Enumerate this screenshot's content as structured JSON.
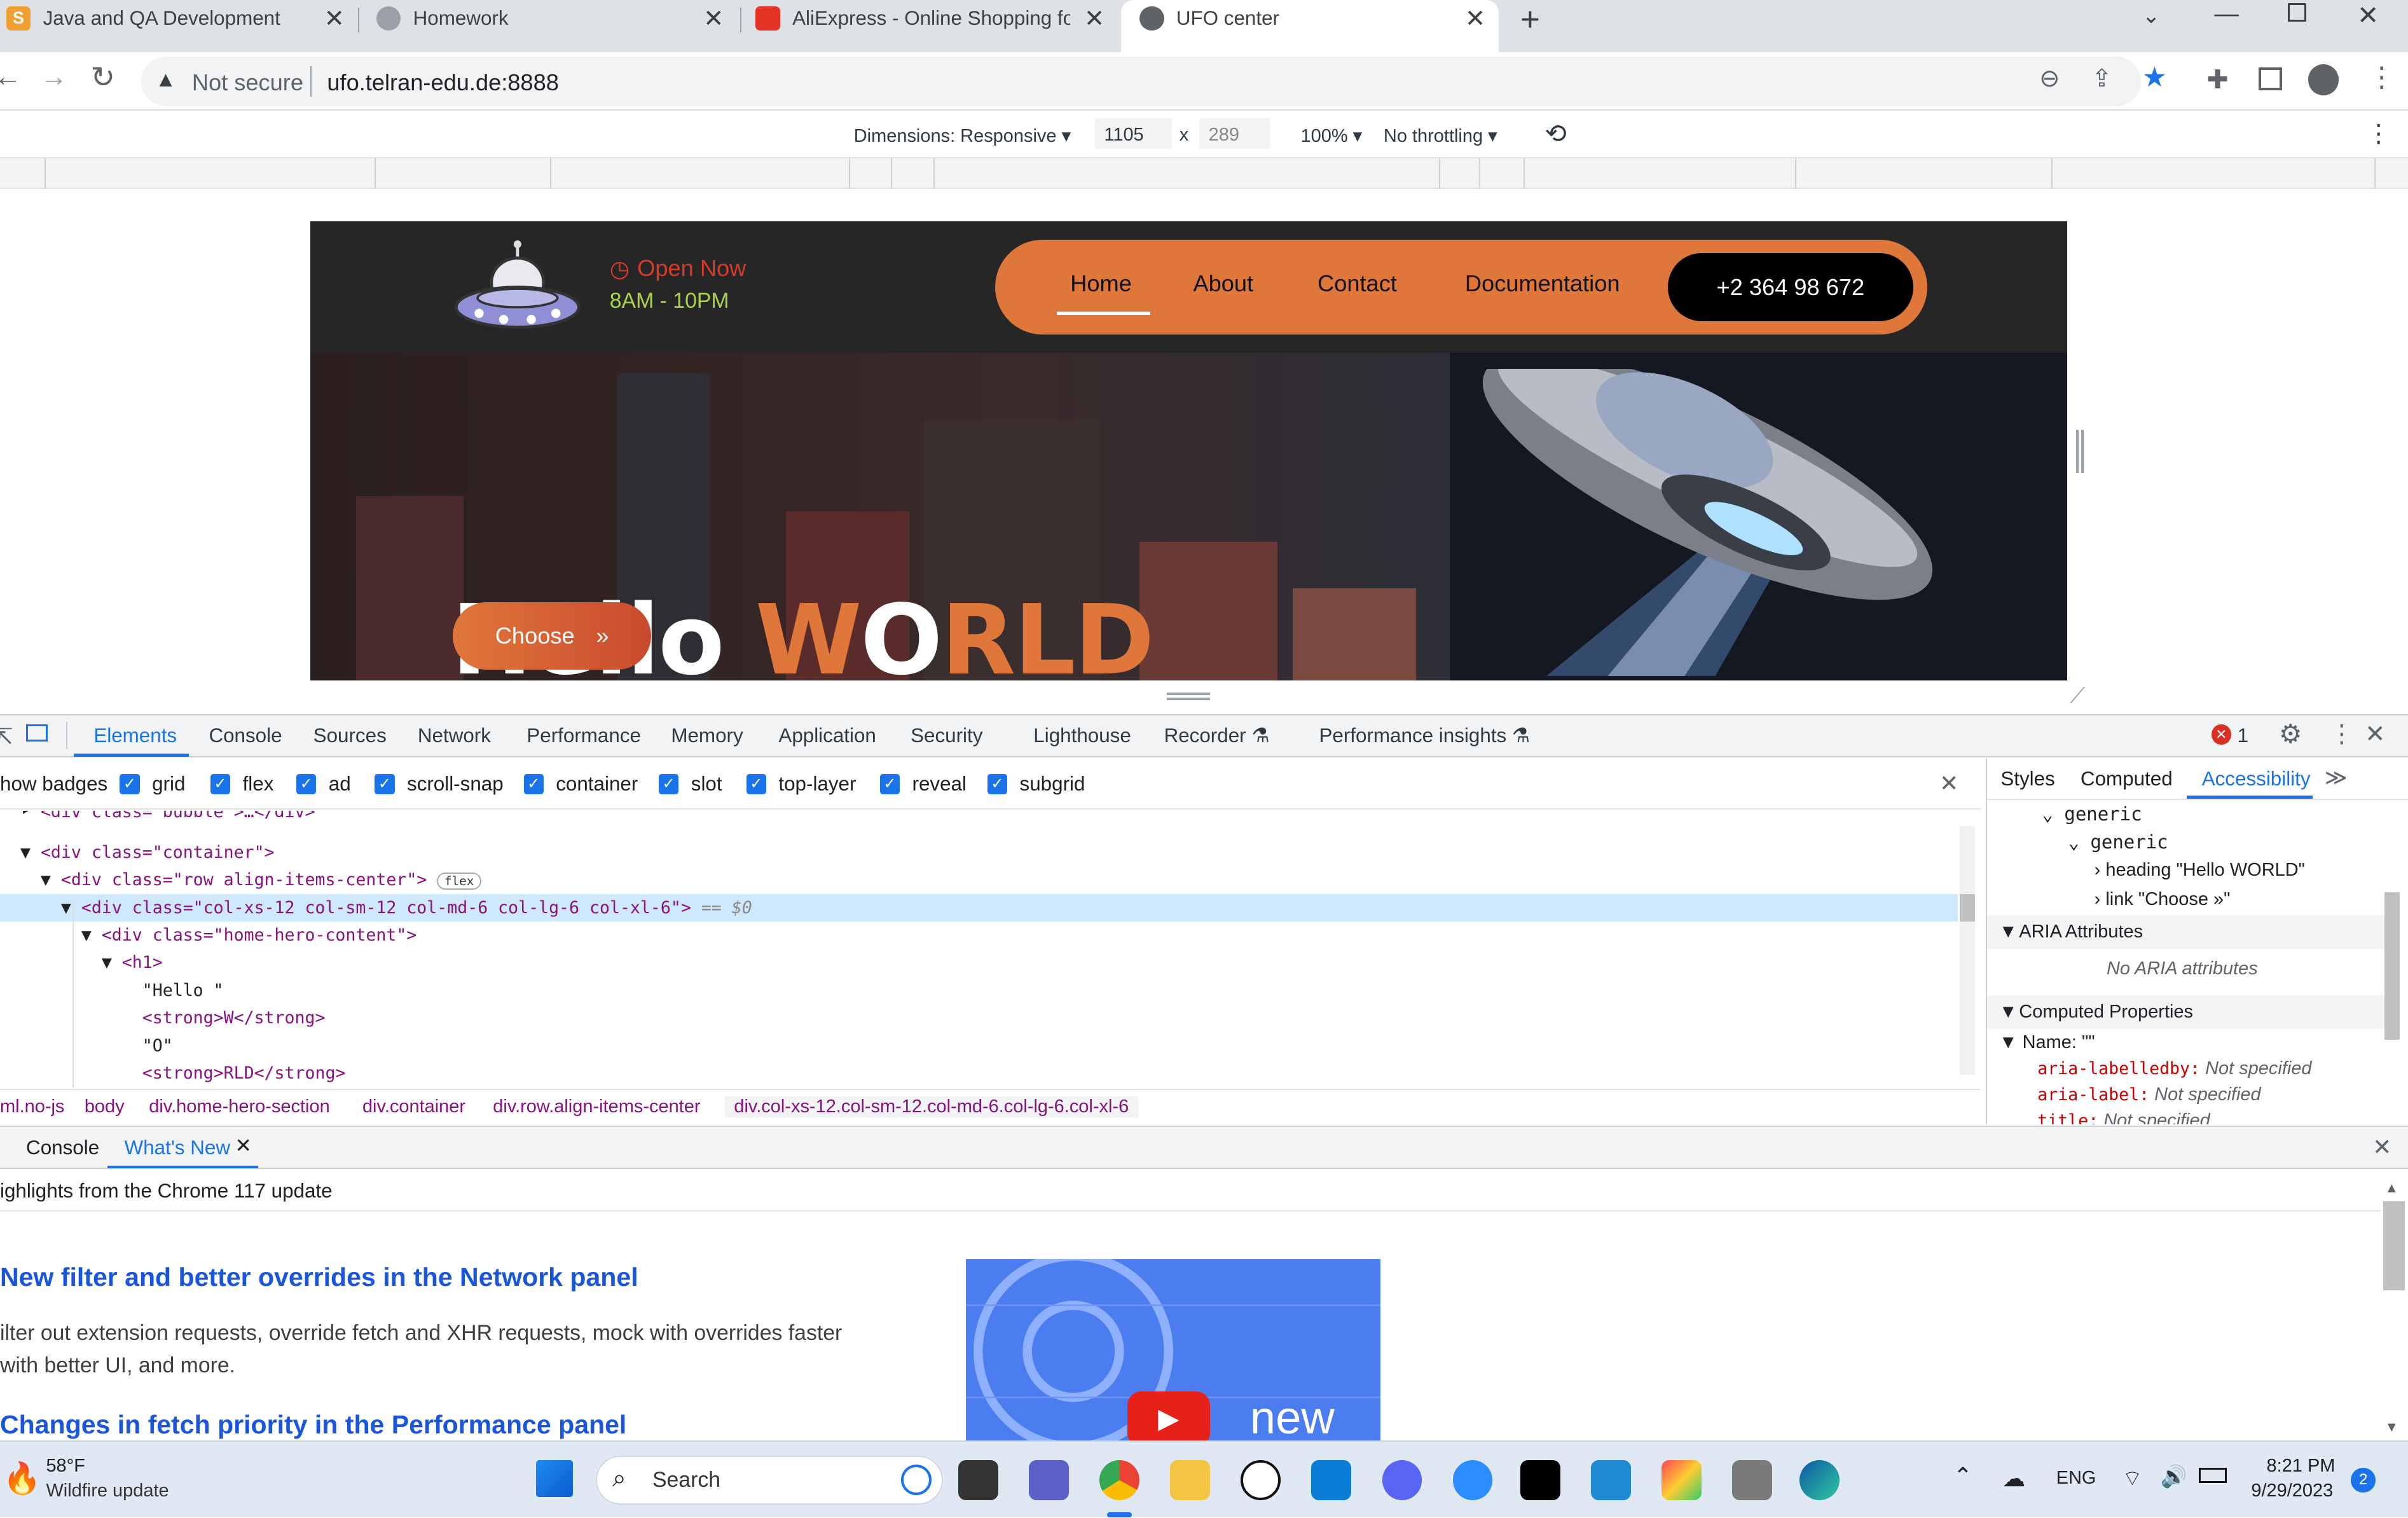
{
  "browser": {
    "tabs": [
      {
        "title": "Java and QA Development",
        "icon": "S"
      },
      {
        "title": "Homework",
        "icon": "gear"
      },
      {
        "title": "AliExpress - Online Shopping for",
        "icon": "ali"
      },
      {
        "title": "UFO center",
        "icon": "globe"
      }
    ],
    "new_tab": "+",
    "security_label": "Not secure",
    "url": "ufo.telran-edu.de:8888"
  },
  "device_toolbar": {
    "dimensions": "Dimensions: Responsive",
    "width": "1105",
    "times": "x",
    "height": "289",
    "zoom": "100%",
    "throttling": "No throttling"
  },
  "site": {
    "open_now": "Open Now",
    "hours": "8AM - 10PM",
    "nav": [
      "Home",
      "About",
      "Contact",
      "Documentation"
    ],
    "phone": "+2 364 98 672",
    "hero_hello": "Hello ",
    "hero_world_a": "W",
    "hero_world_b": "O",
    "hero_world_c": "RLD",
    "choose": "Choose",
    "choose_arrow": "»",
    "colors": {
      "accent": "#e0773a",
      "open": "#d83b2b",
      "hours": "#a8d34a"
    }
  },
  "devtools": {
    "tabs": [
      "Elements",
      "Console",
      "Sources",
      "Network",
      "Performance",
      "Memory",
      "Application",
      "Security",
      "Lighthouse",
      "Recorder",
      "Performance insights"
    ],
    "error_count": "1",
    "badges_label": "how badges",
    "badges": [
      "grid",
      "flex",
      "ad",
      "scroll-snap",
      "container",
      "slot",
      "top-layer",
      "reveal",
      "subgrid"
    ],
    "dom": [
      {
        "pre": "  ‣ ",
        "content": "<div class=\"bubble\">…</div>"
      },
      {
        "pre": "  ▼ ",
        "content": "<div class=\"container\">"
      },
      {
        "pre": "    ▼ ",
        "content": "<div class=\"row align-items-center\">",
        "badge": "flex"
      },
      {
        "pre": "      ▼ ",
        "content": "<div class=\"col-xs-12 col-sm-12 col-md-6 col-lg-6 col-xl-6\">",
        "suffix": " == $0"
      },
      {
        "pre": "        ▼ ",
        "content": "<div class=\"home-hero-content\">"
      },
      {
        "pre": "          ▼ ",
        "content": "<h1>"
      },
      {
        "pre": "              ",
        "content": "\"Hello \""
      },
      {
        "pre": "              ",
        "content": "<strong>W</strong>"
      },
      {
        "pre": "              ",
        "content": "\"O\""
      },
      {
        "pre": "              ",
        "content": "<strong>RLD</strong>"
      }
    ],
    "breadcrumbs": [
      "ml.no-js",
      "body",
      "div.home-hero-section",
      "div.container",
      "div.row.align-items-center",
      "div.col-xs-12.col-sm-12.col-md-6.col-lg-6.col-xl-6"
    ],
    "side_tabs": [
      "Styles",
      "Computed",
      "Accessibility"
    ],
    "a11y_tree": [
      "generic",
      "generic",
      "heading \"Hello WORLD\"",
      "link \"Choose »\""
    ],
    "aria_header": "ARIA Attributes",
    "aria_none": "No ARIA attributes",
    "computed_header": "Computed Properties",
    "name_row": "Name: \"\"",
    "props": [
      {
        "k": "aria-labelledby:",
        "v": "Not specified"
      },
      {
        "k": "aria-label:",
        "v": "Not specified"
      },
      {
        "k": "title:",
        "v": "Not specified"
      }
    ],
    "drawer_tabs": [
      "Console",
      "What's New"
    ],
    "whats_new_header": "ighlights from the Chrome 117 update",
    "article1_title": "New filter and better overrides in the Network panel",
    "article1_body_1": "ilter out extension requests, override fetch and XHR requests, mock with overrides faster",
    "article1_body_2": "with better UI, and more.",
    "article2_title": "Changes in fetch priority in the Performance panel",
    "video_word": "new"
  },
  "taskbar": {
    "weather_temp": "58°F",
    "weather_text": "Wildfire update",
    "search": "Search",
    "lang": "ENG",
    "time": "8:21 PM",
    "date": "9/29/2023",
    "notif": "2"
  }
}
